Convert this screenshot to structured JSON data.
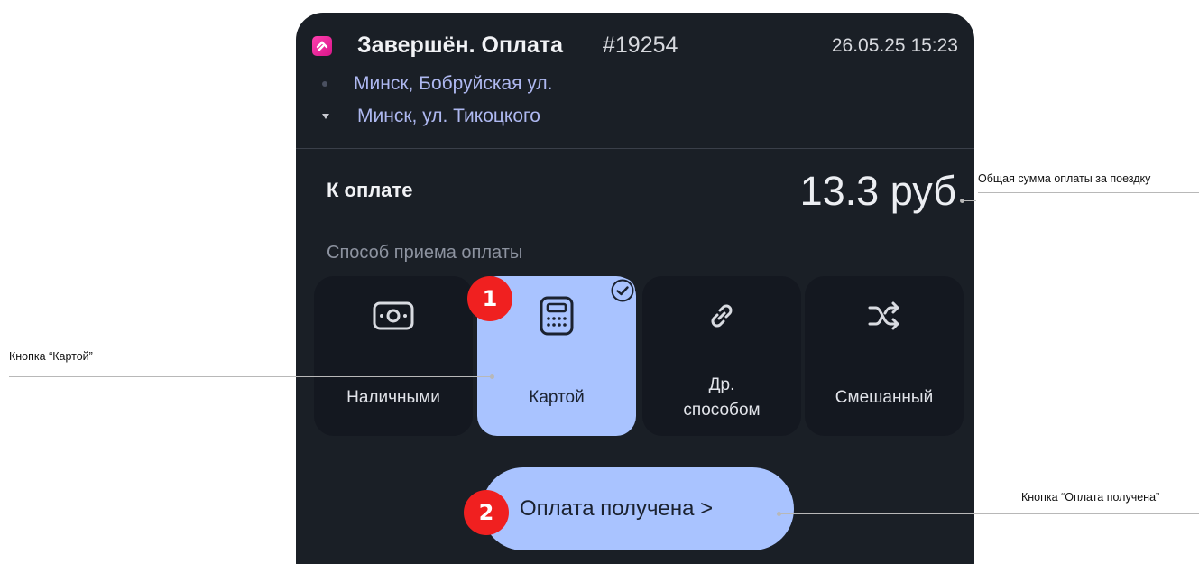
{
  "order": {
    "status_title": "Завершён. Оплата",
    "number": "#19254",
    "datetime": "26.05.25 15:23",
    "route_from": "Минск, Бобруйская ул.",
    "route_to": "Минск, ул. Тикоцкого",
    "app_logo_icon": "taxi-app-logo-icon"
  },
  "payment": {
    "due_label": "К оплате",
    "amount": "13.3 руб",
    "method_heading": "Способ приема оплаты",
    "methods": [
      {
        "label": "Наличными",
        "icon": "cash-icon",
        "selected": false
      },
      {
        "label": "Картой",
        "icon": "card-terminal-icon",
        "selected": true
      },
      {
        "label": "Др.\nспособом",
        "icon": "link-icon",
        "selected": false
      },
      {
        "label": "Смешанный",
        "icon": "shuffle-icon",
        "selected": false
      }
    ],
    "confirm_label": "Оплата получена >"
  },
  "annotations": {
    "amount_note": "Общая сумма оплаты за поездку",
    "card_button_note": "Кнопка “Картой”",
    "confirm_button_note": "Кнопка “Оплата получена”",
    "step_1": "1",
    "step_2": "2"
  },
  "colors": {
    "card_background": "#1a1f26",
    "accent": "#a9c3ff",
    "route_text": "#aeb8f0",
    "step_badge": "#f02020",
    "logo": "#e8239a"
  }
}
